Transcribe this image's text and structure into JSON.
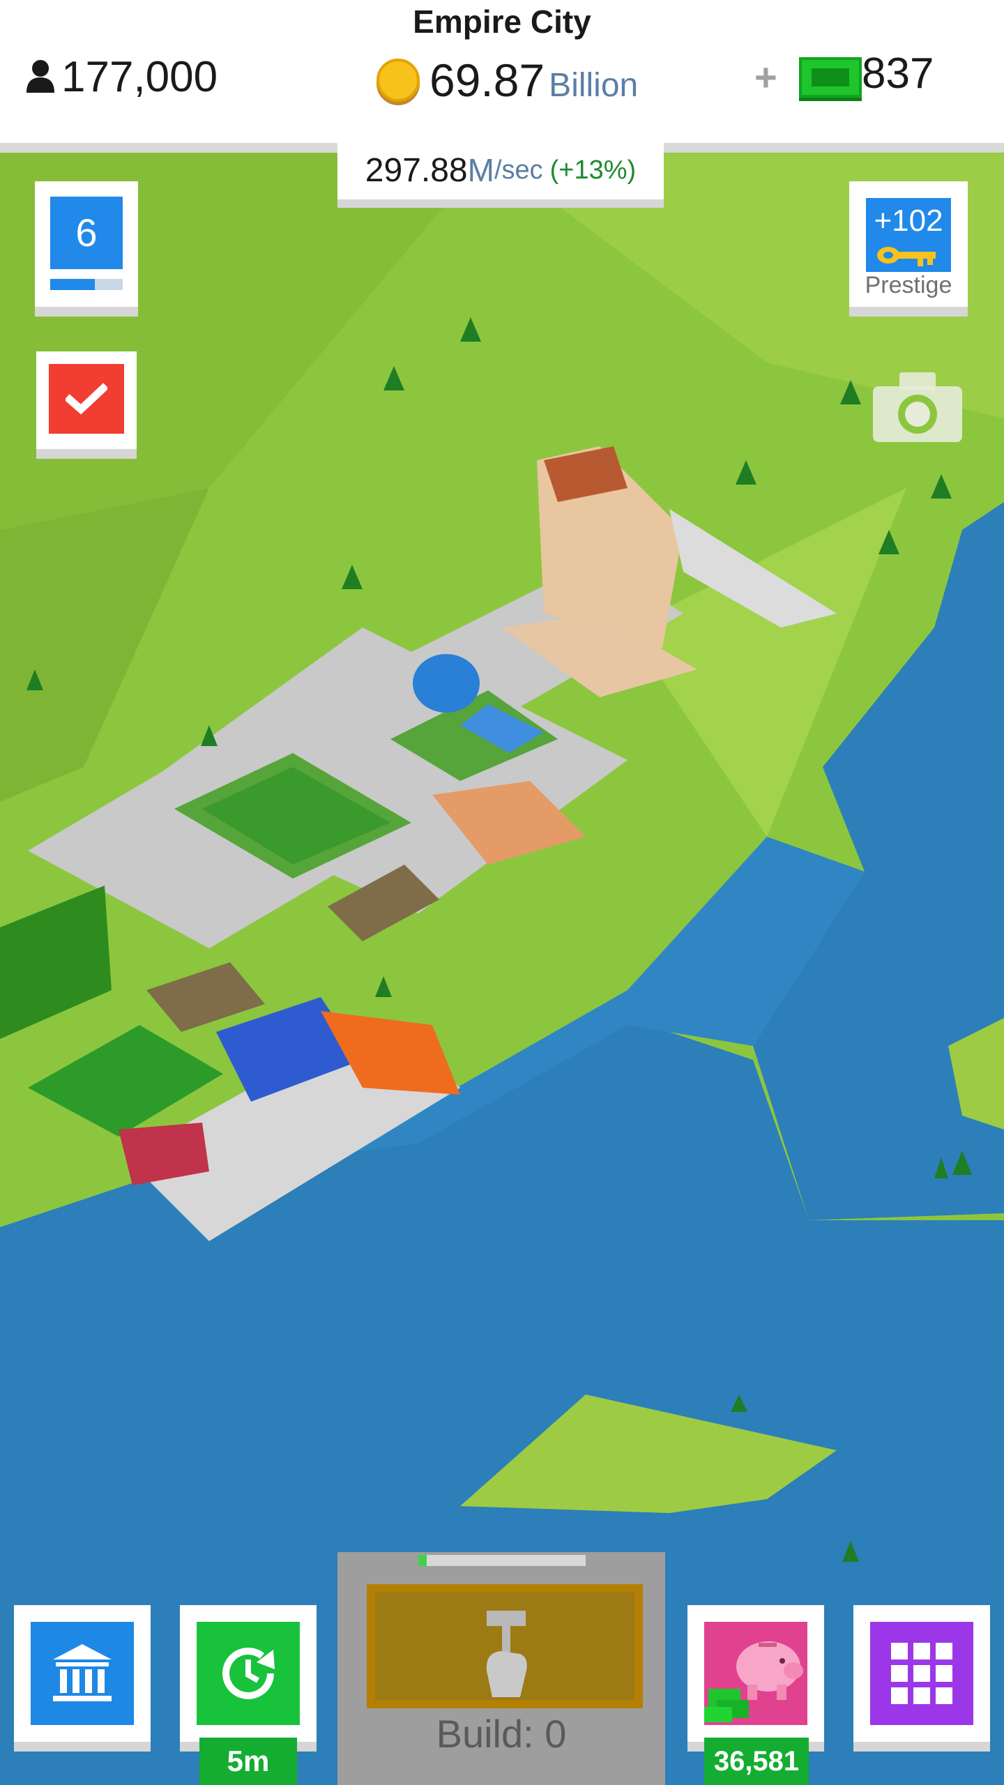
{
  "header": {
    "city_name": "Empire City",
    "population": "177,000",
    "money_value": "69.87",
    "money_unit": "Billion",
    "plus_label": "+",
    "cash_value": "837"
  },
  "rate": {
    "value": "297.88",
    "unit": "M",
    "per": "/sec",
    "bonus": "(+13%)"
  },
  "level": {
    "number": "6",
    "progress": 0.62
  },
  "prestige": {
    "keys": "+102",
    "label": "Prestige"
  },
  "bottom": {
    "boost_time": "5m",
    "build_label": "Build: 0",
    "build_progress": 0.05,
    "piggy_value": "36,581"
  },
  "icons": {
    "population": "person-icon",
    "money": "coin-icon",
    "cash": "cash-icon",
    "task": "checkmark-icon",
    "prestige": "key-icon",
    "camera": "camera-icon",
    "bank": "bank-icon",
    "boost": "clock-refresh-icon",
    "build": "hammer-hand-icon",
    "piggy": "piggy-bank-icon",
    "menu": "grid-icon"
  },
  "colors": {
    "grass": "#8cc63f",
    "water": "#2c7fb8",
    "accent_blue": "#2089ea",
    "accent_green": "#18c23b",
    "accent_red": "#f23d33",
    "accent_purple": "#9b37e8",
    "accent_pink": "#e0428f"
  }
}
